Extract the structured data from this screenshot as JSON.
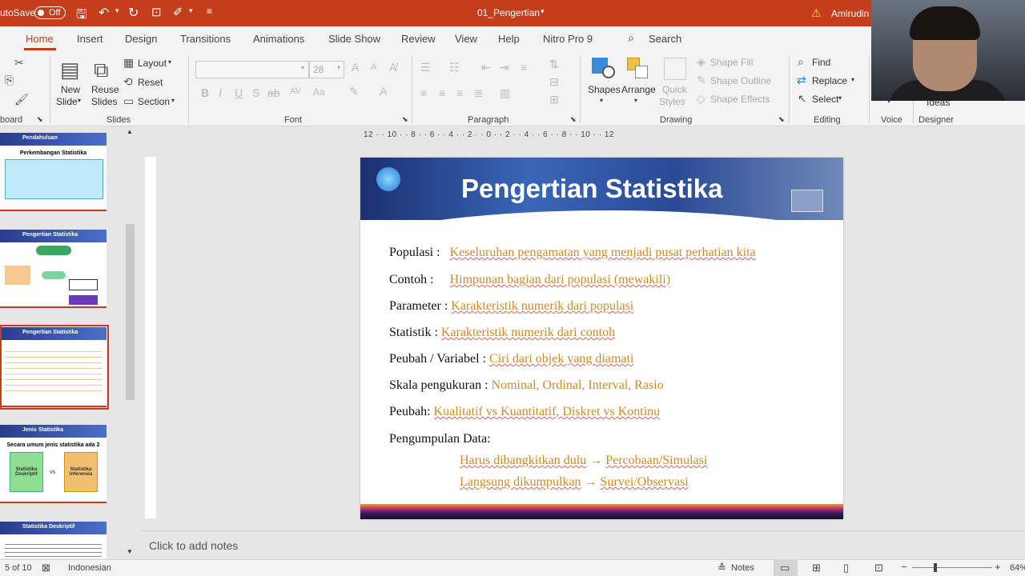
{
  "titlebar": {
    "autosave_label": "utoSave",
    "autosave_state": "Off",
    "filename": "01_Pengertian",
    "user": "Amirudin"
  },
  "tabs": [
    "Home",
    "Insert",
    "Design",
    "Transitions",
    "Animations",
    "Slide Show",
    "Review",
    "View",
    "Help",
    "Nitro Pro 9"
  ],
  "search_label": "Search",
  "ribbon": {
    "clipboard_label": "board",
    "new_slide_line1": "New",
    "new_slide_line2": "Slide",
    "reuse_line1": "Reuse",
    "reuse_line2": "Slides",
    "layout": "Layout",
    "reset": "Reset",
    "section": "Section",
    "slides_label": "Slides",
    "font_size": "28",
    "font_label": "Font",
    "paragraph_label": "Paragraph",
    "shapes": "Shapes",
    "arrange": "Arrange",
    "quick_line1": "Quick",
    "quick_line2": "Styles",
    "shape_fill": "Shape Fill",
    "shape_outline": "Shape Outline",
    "shape_effects": "Shape Effects",
    "drawing_label": "Drawing",
    "find": "Find",
    "replace": "Replace",
    "select": "Select",
    "editing_label": "Editing",
    "voice_label": "Voice",
    "ideas": "Ideas",
    "designer_label": "Designer"
  },
  "thumbs": [
    {
      "title": "Pendahuluan",
      "sub": "Perkembangan Statistika"
    },
    {
      "title": "Pengertian Statistika",
      "sub": ""
    },
    {
      "title": "Pengertian Statistika",
      "sub": ""
    },
    {
      "title": "Jenis Statistika",
      "sub": "Secara umum jenis statistika ada 2"
    },
    {
      "title": "Statistika Deskriptif",
      "sub": ""
    }
  ],
  "thumb4": {
    "left": "Statistika Deskriptif",
    "vs": "vs",
    "right": "Statistika Inferensia"
  },
  "ruler_text": "12 · · 10 · · 8 · · 6 · · 4 · · 2 · · 0 · · 2 · · 4 · · 6 · · 8 · · 10 · · 12",
  "slide": {
    "title": "Pengertian Statistika",
    "rows": [
      {
        "label": "Populasi :",
        "value": "Keseluruhan pengamatan yang menjadi pusat perhatian kita"
      },
      {
        "label": "Contoh   :",
        "value": "Himpunan bagian dari populasi (mewakili)"
      },
      {
        "label": "Parameter :",
        "value": "Karakteristik numerik dari populasi"
      },
      {
        "label": "Statistik    :",
        "value": "Karakteristik numerik dari contoh"
      },
      {
        "label": "Peubah / Variabel :",
        "value": "Ciri dari objek yang diamati"
      },
      {
        "label": "Skala pengukuran :",
        "value": "Nominal, Ordinal, Interval, Rasio"
      },
      {
        "label": "Peubah:",
        "value": "Kualitatif vs Kuantitatif,  Diskret vs Kontinu"
      },
      {
        "label": "Pengumpulan Data:",
        "value": ""
      }
    ],
    "sub1_left": "Harus dibangkitkan dulu",
    "sub1_right": "Percobaan/Simulasi",
    "sub2_left": "Langsung dikumpulkan",
    "sub2_right": "Survei/Observasi",
    "arrow": "→"
  },
  "notes_placeholder": "Click to add notes",
  "status": {
    "slide_of": "5 of 10",
    "language": "Indonesian",
    "notes": "Notes",
    "zoom": "64%"
  }
}
